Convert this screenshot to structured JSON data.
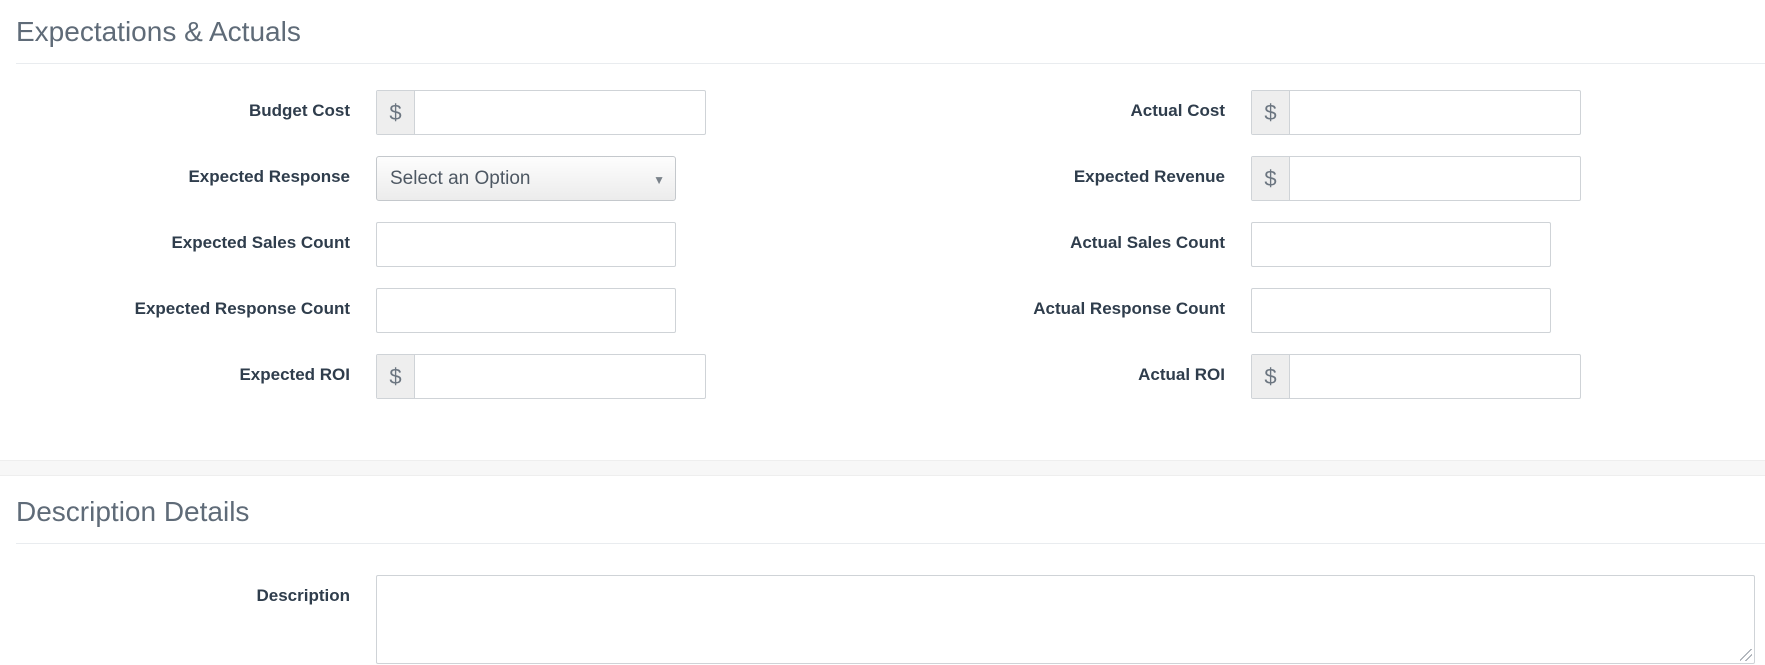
{
  "expectations": {
    "title": "Expectations & Actuals",
    "currency_symbol": "$",
    "budget_cost_label": "Budget Cost",
    "actual_cost_label": "Actual Cost",
    "expected_response_label": "Expected Response",
    "expected_response_value": "Select an Option",
    "expected_revenue_label": "Expected Revenue",
    "expected_sales_count_label": "Expected Sales Count",
    "actual_sales_count_label": "Actual Sales Count",
    "expected_response_count_label": "Expected Response Count",
    "actual_response_count_label": "Actual Response Count",
    "expected_roi_label": "Expected ROI",
    "actual_roi_label": "Actual ROI"
  },
  "description_details": {
    "title": "Description Details",
    "description_label": "Description"
  }
}
